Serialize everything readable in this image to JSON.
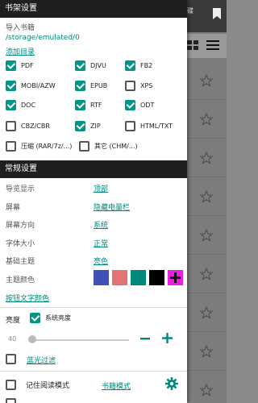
{
  "background": {
    "tab_text": "碟",
    "star_count": 9
  },
  "shelf": {
    "header": "书架设置",
    "import_label": "导入书籍",
    "path": "/storage/emulated/0",
    "add_dir": "添加目录",
    "formats": [
      {
        "label": "PDF",
        "checked": true
      },
      {
        "label": "DJVU",
        "checked": true
      },
      {
        "label": "FB2",
        "checked": true
      },
      {
        "label": "MOBI/AZW",
        "checked": true
      },
      {
        "label": "EPUB",
        "checked": true
      },
      {
        "label": "XPS",
        "checked": false
      },
      {
        "label": "DOC",
        "checked": true
      },
      {
        "label": "RTF",
        "checked": true
      },
      {
        "label": "ODT",
        "checked": true
      },
      {
        "label": "CBZ/CBR",
        "checked": false
      },
      {
        "label": "ZIP",
        "checked": true
      },
      {
        "label": "HTML/TXT",
        "checked": false
      },
      {
        "label": "压缩 (RAR/7z/...)",
        "checked": false
      },
      {
        "label": "其它 (CHM/...)",
        "checked": false
      }
    ]
  },
  "general": {
    "header": "常规设置",
    "rows": [
      {
        "label": "导览显示",
        "value": "顶部"
      },
      {
        "label": "屏幕",
        "value": "隐藏电量栏"
      },
      {
        "label": "屏幕方向",
        "value": "系统"
      },
      {
        "label": "字体大小",
        "value": "正常"
      },
      {
        "label": "基础主题",
        "value": "亮色"
      }
    ],
    "theme_color_label": "主题颜色",
    "swatches": [
      "#3f51b5",
      "#e57373",
      "#00897b",
      "#000000",
      "#e91ee0"
    ],
    "button_text_color": "按钮文字颜色",
    "brightness_label": "亮度",
    "system_brightness": "系统亮度",
    "brightness_value": "40",
    "blue_filter": "蓝光过滤",
    "remember_mode": "记住阅读模式",
    "book_mode": "书籍模式"
  },
  "colors": {
    "accent": "#009688",
    "header_bg": "#1f1f1f"
  }
}
